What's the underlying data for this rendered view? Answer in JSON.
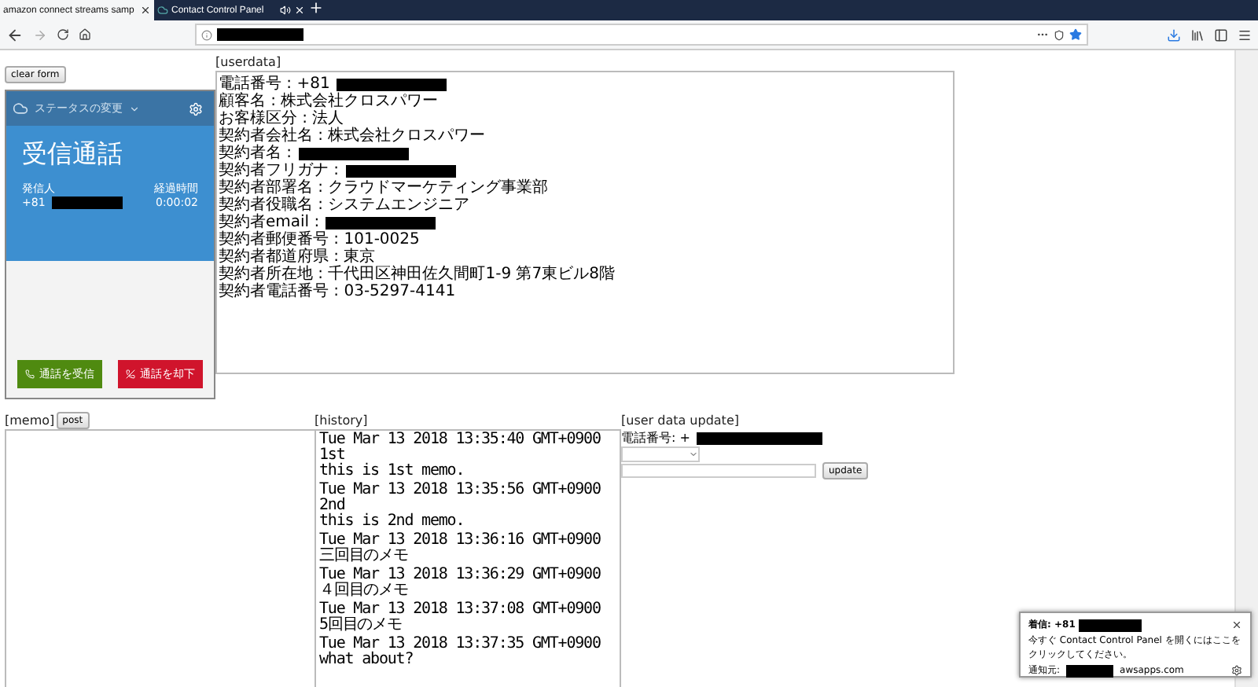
{
  "browser": {
    "tabs": [
      {
        "title": "amazon connect streams samp",
        "selected": true,
        "kind": "page"
      },
      {
        "title": "Contact Control Panel",
        "selected": false,
        "kind": "audio"
      }
    ]
  },
  "page": {
    "clear_button": "clear form",
    "userdata_label": "[userdata]",
    "ccp": {
      "status": "ステータスの変更",
      "title": "受信通話",
      "caller_label": "発信人",
      "caller_number": "+81",
      "elapsed_label": "経過時間",
      "elapsed": "0:00:02",
      "accept": "通話を受信",
      "reject": "通話を却下"
    },
    "userdata_lines": [
      {
        "text": "電話番号 : +81",
        "redacted": true
      },
      {
        "text": "顧客名 : 株式会社クロスパワー",
        "redacted": false
      },
      {
        "text": "お客様区分 : 法人",
        "redacted": false
      },
      {
        "text": "契約者会社名 : 株式会社クロスパワー",
        "redacted": false
      },
      {
        "text": "契約者名 :",
        "redacted": true
      },
      {
        "text": "契約者フリガナ :",
        "redacted": true
      },
      {
        "text": "契約者部署名 : クラウドマーケティング事業部",
        "redacted": false
      },
      {
        "text": "契約者役職名 : システムエンジニア",
        "redacted": false
      },
      {
        "text": "契約者email :",
        "redacted": true
      },
      {
        "text": "契約者郵便番号 : 101-0025",
        "redacted": false
      },
      {
        "text": "契約者都道府県 : 東京",
        "redacted": false
      },
      {
        "text": "契約者所在地 : 千代田区神田佐久間町1-9 第7東ビル8階",
        "redacted": false
      },
      {
        "text": "契約者電話番号 : 03-5297-4141",
        "redacted": false
      }
    ],
    "memo_label": "[memo]",
    "post_button": "post",
    "history_label": "[history]",
    "history": [
      {
        "time": "Tue Mar 13 2018 13:35:40 GMT+0900",
        "lines": [
          "1st",
          "this is 1st memo."
        ]
      },
      {
        "time": "Tue Mar 13 2018 13:35:56 GMT+0900",
        "lines": [
          "2nd",
          "this is 2nd memo."
        ]
      },
      {
        "time": "Tue Mar 13 2018 13:36:16 GMT+0900",
        "lines": [
          "三回目のメモ"
        ]
      },
      {
        "time": "Tue Mar 13 2018 13:36:29 GMT+0900",
        "lines": [
          "４回目のメモ"
        ]
      },
      {
        "time": "Tue Mar 13 2018 13:37:08 GMT+0900",
        "lines": [
          "5回目のメモ"
        ]
      },
      {
        "time": "Tue Mar 13 2018 13:37:35 GMT+0900",
        "lines": [
          "what about?"
        ]
      }
    ],
    "update_label": "[user data update]",
    "update_phone": "電話番号: +",
    "update_button": "update"
  },
  "notification": {
    "title": "着信: +81",
    "body": "今すぐ Contact Control Panel を開くにはここをクリックしてください。",
    "source_label": "通知元:",
    "source_domain": "awsapps.com"
  }
}
